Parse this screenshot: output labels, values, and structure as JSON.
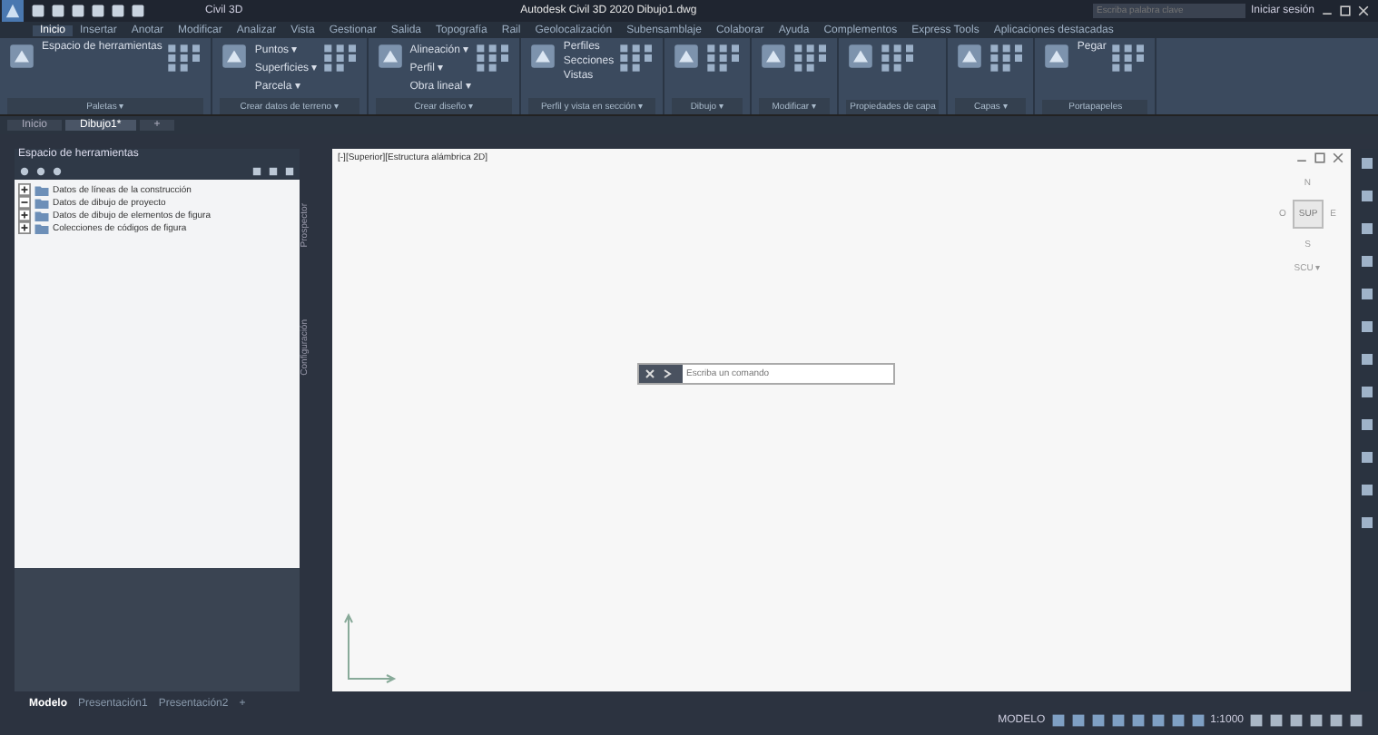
{
  "title_bar": {
    "workspace": "Civil 3D",
    "title": "Autodesk Civil 3D 2020  Dibujo1.dwg",
    "search": {
      "placeholder": "Escriba palabra clave"
    },
    "user": "Iniciar sesión"
  },
  "ribbon_tabs": [
    {
      "label": "Inicio",
      "selected": true
    },
    {
      "label": "Insertar",
      "selected": false
    },
    {
      "label": "Anotar",
      "selected": false
    },
    {
      "label": "Modificar",
      "selected": false
    },
    {
      "label": "Analizar",
      "selected": false
    },
    {
      "label": "Vista",
      "selected": false
    },
    {
      "label": "Gestionar",
      "selected": false
    },
    {
      "label": "Salida",
      "selected": false
    },
    {
      "label": "Topografía",
      "selected": false
    },
    {
      "label": "Rail",
      "selected": false
    },
    {
      "label": "Geolocalización",
      "selected": false
    },
    {
      "label": "Subensamblaje",
      "selected": false
    },
    {
      "label": "Colaborar",
      "selected": false
    },
    {
      "label": "Ayuda",
      "selected": false
    },
    {
      "label": "Complementos",
      "selected": false
    },
    {
      "label": "Express Tools",
      "selected": false
    },
    {
      "label": "Aplicaciones destacadas",
      "selected": false
    }
  ],
  "ribbon_panels": [
    {
      "title": "Paletas ▾",
      "tools": [
        "Espacio de herramientas"
      ]
    },
    {
      "title": "Crear datos de terreno ▾",
      "tools": [
        "Puntos ▾",
        "Superficies ▾",
        "Parcela ▾"
      ]
    },
    {
      "title": "Crear diseño ▾",
      "tools": [
        "Alineación ▾",
        "Perfil ▾",
        "Obra lineal ▾"
      ]
    },
    {
      "title": "Perfil y vista en sección ▾",
      "tools": [
        "Perfiles",
        "Secciones",
        "Vistas"
      ]
    },
    {
      "title": "Dibujo ▾"
    },
    {
      "title": "Modificar ▾"
    },
    {
      "title": "Propiedades de capa"
    },
    {
      "title": "Capas ▾"
    },
    {
      "title": "Portapapeles",
      "tools": [
        "Pegar"
      ]
    }
  ],
  "doc_tabs": [
    {
      "label": "Inicio",
      "selected": false
    },
    {
      "label": "Dibujo1*",
      "selected": true
    },
    {
      "label": "+",
      "selected": false
    }
  ],
  "toolspace": {
    "title": "Espacio de herramientas",
    "tree": [
      {
        "label": "Datos de líneas de la construcción",
        "expanded": false
      },
      {
        "label": "Datos de dibujo de proyecto",
        "expanded": true
      },
      {
        "label": "Datos de dibujo de elementos de figura",
        "expanded": false
      },
      {
        "label": "Colecciones de códigos de figura",
        "expanded": false
      }
    ],
    "side_tabs": [
      "Prospector",
      "Configuración"
    ]
  },
  "viewport": {
    "label": "[-][Superior][Estructura alámbrica 2D]",
    "viewcube": {
      "top": "N",
      "left": "O",
      "center": "SUP",
      "right": "E",
      "bottom": "S",
      "wcs": "SCU ▾"
    }
  },
  "command_line": {
    "placeholder": "Escriba un comando"
  },
  "layout_tabs": [
    {
      "label": "Modelo",
      "selected": true
    },
    {
      "label": "Presentación1",
      "selected": false
    },
    {
      "label": "Presentación2",
      "selected": false
    },
    {
      "label": "+",
      "selected": false
    }
  ],
  "status_bar": {
    "mode": "MODELO",
    "scale": "1:1000"
  }
}
